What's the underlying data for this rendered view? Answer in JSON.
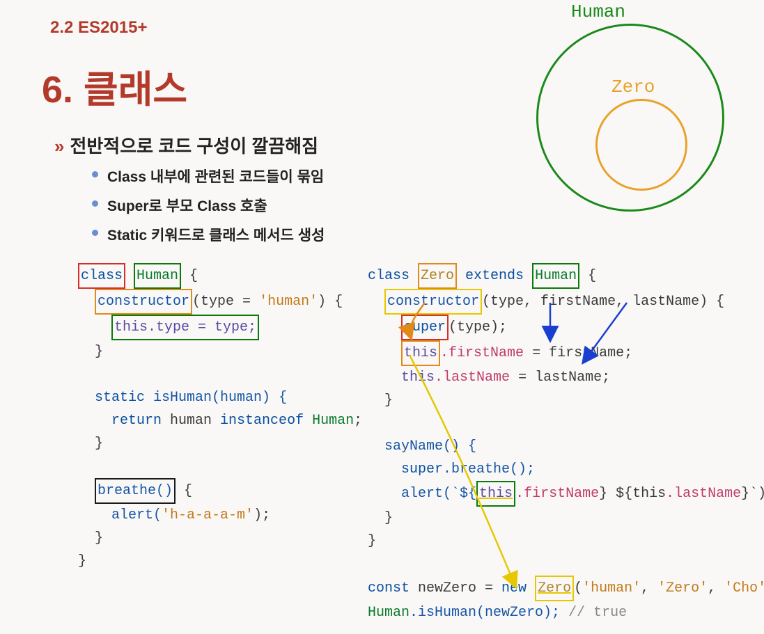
{
  "section": "2.2 ES2015+",
  "heading": "6. 클래스",
  "intro_marker": "»",
  "intro": "전반적으로 코드 구성이 깔끔해짐",
  "bullets": [
    "Class 내부에 관련된 코드들이 묶임",
    "Super로 부모 Class 호출",
    "Static 키워드로 클래스 메서드 생성"
  ],
  "diagram": {
    "outer": "Human",
    "inner": "Zero"
  },
  "code_left": {
    "t_class": "class",
    "t_Human": "Human",
    "brace_o": " {",
    "t_constructor": "constructor",
    "params1": "(type = ",
    "str_human": "'human'",
    "params1_end": ") {",
    "t_this_type": "this.type = type;",
    "brace_c": "}",
    "t_static": "static",
    "t_isHuman": " isHuman(human) {",
    "t_return": "return",
    "t_inst": " human ",
    "t_instanceof": "instanceof",
    "t_Human2": " Human",
    "semi": ";",
    "t_breathe": "breathe()",
    "breathe_brace": " {",
    "t_alert": "alert(",
    "str_haam": "'h-a-a-a-m'",
    "alert_end": ");"
  },
  "code_right": {
    "t_class": "class",
    "t_Zero": "Zero",
    "t_extends": " extends ",
    "t_Human": "Human",
    "brace_o": " {",
    "t_constructor": "constructor",
    "params": "(type, firstName, lastName) {",
    "t_super": "super",
    "super_args": "(type);",
    "t_this": "this",
    "t_firstName": ".firstName",
    "assign_fn": " = firstName;",
    "this2": "this",
    "t_lastName": ".lastName",
    "assign_ln": " = lastName;",
    "brace_c": "}",
    "t_sayName": "sayName() {",
    "t_super_breathe": "super",
    "breathe_call": ".breathe();",
    "t_alert": "alert(`${",
    "t_this3": "this",
    "t_fn2": ".firstName",
    "mid": "} ${this",
    "t_ln2": ".lastName",
    "end_tpl": "}`);",
    "t_const": "const",
    "t_newZero": " newZero = ",
    "t_new": "new",
    "t_Zero2": "Zero",
    "args": "(",
    "s1": "'human'",
    "c": ", ",
    "s2": "'Zero'",
    "s3": "'Cho'",
    "args_end": ");",
    "t_HumanCall": "Human",
    "isHumanCall": ".isHuman(newZero); ",
    "cmt": "// true"
  }
}
